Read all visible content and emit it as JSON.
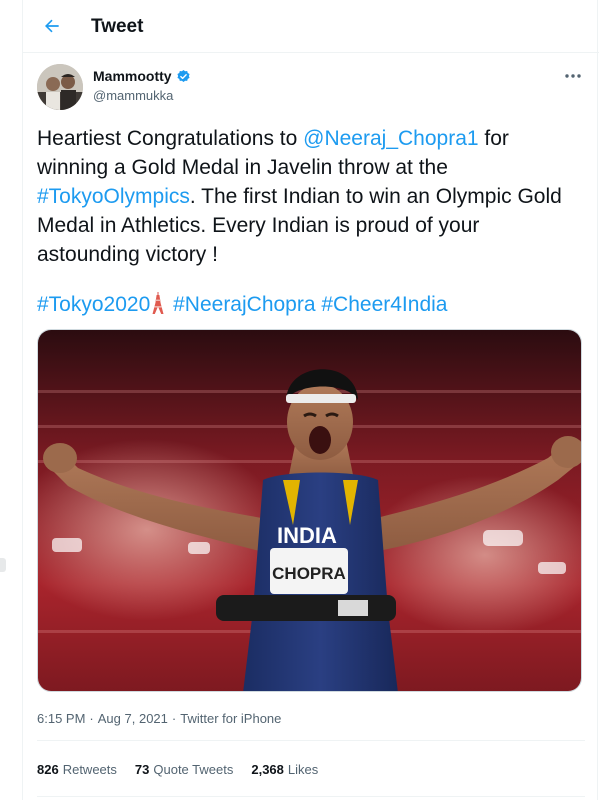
{
  "header": {
    "title": "Tweet",
    "back_icon": "arrow-left-icon"
  },
  "author": {
    "name": "Mammootty",
    "handle": "@mammukka",
    "verified": true,
    "avatar": "avatar"
  },
  "tweet": {
    "text_before_mention": "Heartiest Congratulations to ",
    "mention": "@Neeraj_Chopra1",
    "text_after_mention": " for winning a Gold Medal in Javelin throw at the ",
    "hashtag_inline": "#TokyoOlympics",
    "text_end": ". The first Indian to win an Olympic Gold Medal in Athletics. Every Indian is proud of your astounding victory !",
    "hashtag_1": "#Tokyo2020",
    "emoji": "tokyo-tower-icon",
    "hashtag_2": "#NeerajChopra",
    "hashtag_3": "#Cheer4India",
    "photo_labels": {
      "bib_country": "INDIA",
      "bib_name": "CHOPRA"
    }
  },
  "meta": {
    "time": "6:15 PM",
    "separator_1": "·",
    "date": "Aug 7, 2021",
    "separator_2": "·",
    "source": "Twitter for iPhone"
  },
  "stats": {
    "retweets_count": "826",
    "retweets_label": "Retweets",
    "quotes_count": "73",
    "quotes_label": "Quote Tweets",
    "likes_count": "2,368",
    "likes_label": "Likes"
  },
  "colors": {
    "link": "#1d9bf0",
    "text": "#0f1419",
    "muted": "#536471",
    "verified": "#1d9bf0"
  }
}
